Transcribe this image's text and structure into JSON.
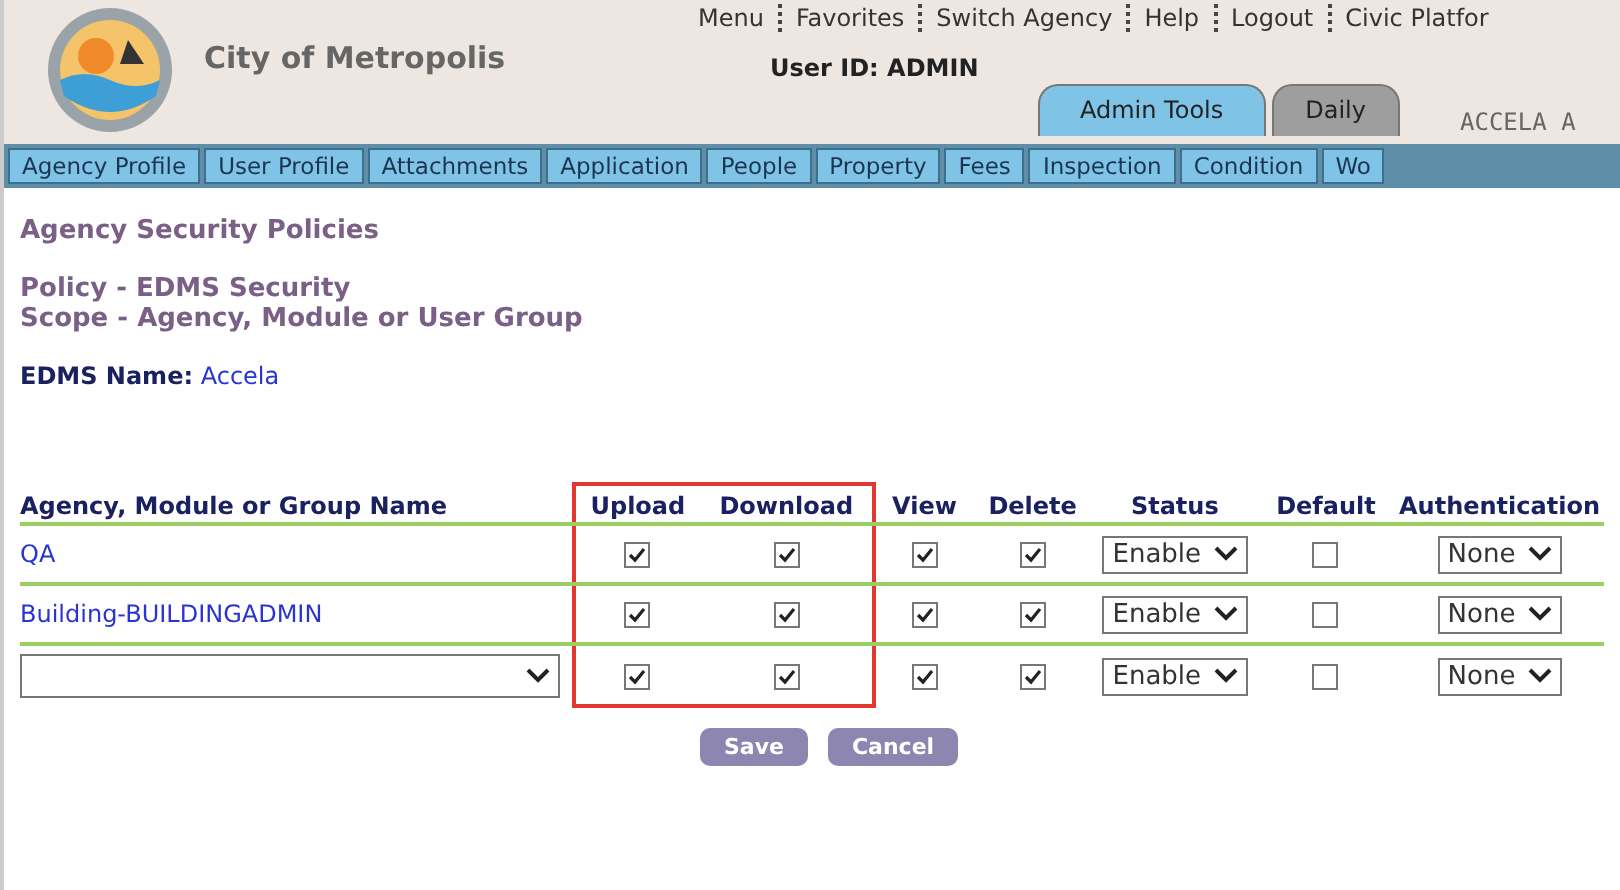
{
  "header": {
    "agency_name": "City of Metropolis",
    "top_links": [
      "Menu",
      "Favorites",
      "Switch Agency",
      "Help",
      "Logout",
      "Civic Platfor"
    ],
    "user_label": "User ID:",
    "user_id": "ADMIN",
    "tabs": [
      {
        "label": "Admin Tools",
        "selected": true
      },
      {
        "label": "Daily",
        "selected": false
      }
    ],
    "brand_text": "ACCELA A"
  },
  "nav": [
    {
      "label": "Agency Profile",
      "selected": false
    },
    {
      "label": "User Profile",
      "selected": false
    },
    {
      "label": "Attachments",
      "selected": false
    },
    {
      "label": "Application",
      "selected": false
    },
    {
      "label": "People",
      "selected": false
    },
    {
      "label": "Property",
      "selected": false
    },
    {
      "label": "Fees",
      "selected": false
    },
    {
      "label": "Inspection",
      "selected": false
    },
    {
      "label": "Condition",
      "selected": false
    },
    {
      "label": "Wo",
      "selected": false
    }
  ],
  "page_title": "Agency Security Policies",
  "policy": "Policy - EDMS Security",
  "scope": "Scope - Agency, Module or User Group",
  "edms_label": "EDMS Name:",
  "edms_value": "Accela",
  "table": {
    "columns": [
      {
        "label": "Agency, Module or Group Name",
        "highlighted": false
      },
      {
        "label": "Upload",
        "highlighted": true
      },
      {
        "label": "Download",
        "highlighted": true
      },
      {
        "label": "View",
        "highlighted": false
      },
      {
        "label": "Delete",
        "highlighted": false
      },
      {
        "label": "Status",
        "highlighted": false
      },
      {
        "label": "Default",
        "highlighted": false
      },
      {
        "label": "Authentication",
        "highlighted": false
      }
    ],
    "rows": [
      {
        "kind": "link",
        "name": "QA",
        "upload": true,
        "download": true,
        "view": true,
        "delete": true,
        "status": "Enable",
        "default": false,
        "authentication": "None"
      },
      {
        "kind": "link",
        "name": "Building-BUILDINGADMIN",
        "upload": true,
        "download": true,
        "view": true,
        "delete": true,
        "status": "Enable",
        "default": false,
        "authentication": "None"
      },
      {
        "kind": "select",
        "upload": true,
        "download": true,
        "view": true,
        "delete": true,
        "status": "Enable",
        "default": false,
        "authentication": "None"
      }
    ]
  },
  "buttons": [
    "Save",
    "Cancel"
  ]
}
